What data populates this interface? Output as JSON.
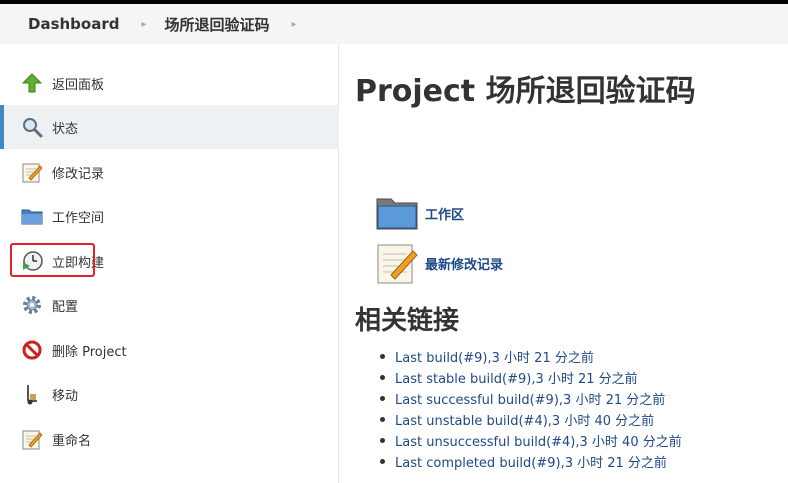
{
  "breadcrumb": {
    "items": [
      "Dashboard",
      "场所退回验证码"
    ]
  },
  "sidebar": {
    "items": [
      {
        "label": "返回面板",
        "icon": "up-arrow-icon"
      },
      {
        "label": "状态",
        "icon": "search-icon",
        "active": true
      },
      {
        "label": "修改记录",
        "icon": "notepad-icon"
      },
      {
        "label": "工作空间",
        "icon": "folder-icon"
      },
      {
        "label": "立即构建",
        "icon": "clock-play-icon"
      },
      {
        "label": "配置",
        "icon": "gear-icon",
        "highlighted": true
      },
      {
        "label": "删除 Project",
        "icon": "no-entry-icon"
      },
      {
        "label": "移动",
        "icon": "hand-truck-icon"
      },
      {
        "label": "重命名",
        "icon": "notepad-icon"
      }
    ]
  },
  "main": {
    "title": "Project 场所退回验证码",
    "workspace_link": "工作区",
    "changes_link": "最新修改记录",
    "related_title": "相关链接",
    "related_links": [
      {
        "link": "Last build(#9)",
        "time": ",3 小时 21 分之前"
      },
      {
        "link": "Last stable build(#9)",
        "time": ",3 小时 21 分之前"
      },
      {
        "link": "Last successful build(#9)",
        "time": ",3 小时 21 分之前"
      },
      {
        "link": "Last unstable build(#4)",
        "time": ",3 小时 40 分之前"
      },
      {
        "link": "Last unsuccessful build(#4)",
        "time": ",3 小时 40 分之前"
      },
      {
        "link": "Last completed build(#9)",
        "time": ",3 小时 21 分之前"
      }
    ]
  },
  "colors": {
    "accent": "#3f88c5",
    "link": "#204a87",
    "highlight": "#e0202a"
  }
}
